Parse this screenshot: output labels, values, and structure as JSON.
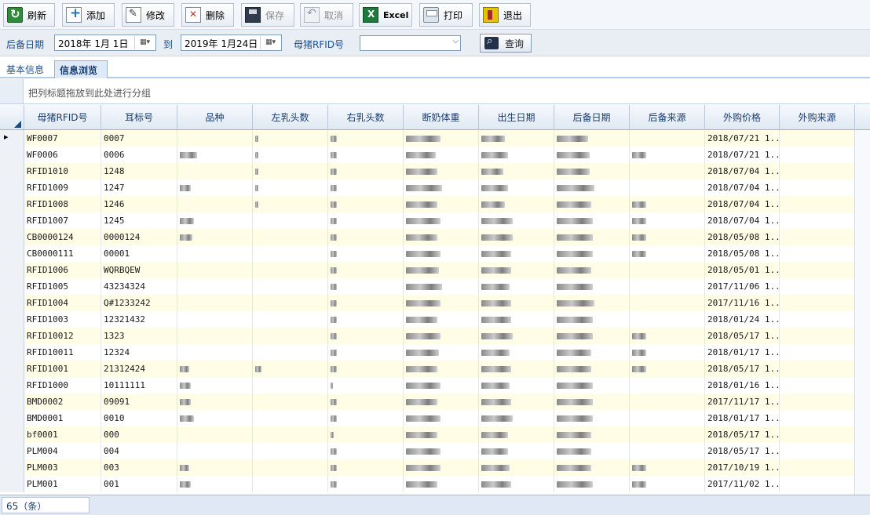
{
  "toolbar": {
    "buttons": [
      {
        "label": "刷新",
        "icon": "refresh-icon"
      },
      {
        "label": "添加",
        "icon": "add-icon"
      },
      {
        "label": "修改",
        "icon": "edit-icon"
      },
      {
        "label": "删除",
        "icon": "delete-icon"
      },
      {
        "label": "保存",
        "icon": "save-icon",
        "disabled": true
      },
      {
        "label": "取消",
        "icon": "cancel-icon",
        "disabled": true
      },
      {
        "label": "Excel",
        "icon": "excel-icon"
      },
      {
        "label": "打印",
        "icon": "print-icon"
      },
      {
        "label": "退出",
        "icon": "exit-icon"
      }
    ]
  },
  "filter": {
    "date_label": "后备日期",
    "start_date": "2018年 1月 1日",
    "to_label": "到",
    "end_date": "2019年 1月24日",
    "rfid_label": "母猪RFID号",
    "rfid_value": "",
    "query_label": "查询"
  },
  "tabs": [
    {
      "label": "基本信息",
      "active": false
    },
    {
      "label": "信息浏览",
      "active": true
    }
  ],
  "group_hint": "把列标题拖放到此处进行分组",
  "grid": {
    "columns": [
      "母猪RFID号",
      "耳标号",
      "品种",
      "左乳头数",
      "右乳头数",
      "断奶体重",
      "出生日期",
      "后备日期",
      "后备来源",
      "外购价格",
      "外购来源"
    ],
    "rows": [
      {
        "rfid": "WF0007",
        "ear": "0007",
        "price": "2018/07/21 1..."
      },
      {
        "rfid": "WF0006",
        "ear": "0006",
        "price": "2018/07/21 1..."
      },
      {
        "rfid": "RFID1010",
        "ear": "1248",
        "price": "2018/07/04 1..."
      },
      {
        "rfid": "RFID1009",
        "ear": "1247",
        "price": "2018/07/04 1..."
      },
      {
        "rfid": "RFID1008",
        "ear": "1246",
        "price": "2018/07/04 1..."
      },
      {
        "rfid": "RFID1007",
        "ear": "1245",
        "price": "2018/07/04 1..."
      },
      {
        "rfid": "CB0000124",
        "ear": "0000124",
        "price": "2018/05/08 1..."
      },
      {
        "rfid": "CB0000111",
        "ear": "00001",
        "price": "2018/05/08 1..."
      },
      {
        "rfid": "RFID1006",
        "ear": "WQRBQEW",
        "price": "2018/05/01 1..."
      },
      {
        "rfid": "RFID1005",
        "ear": "43234324",
        "price": "2017/11/06 1..."
      },
      {
        "rfid": "RFID1004",
        "ear": "Q#1233242",
        "price": "2017/11/16 1..."
      },
      {
        "rfid": "RFID1003",
        "ear": "12321432",
        "price": "2018/01/24 1..."
      },
      {
        "rfid": "RFID10012",
        "ear": "1323",
        "price": "2018/05/17 1..."
      },
      {
        "rfid": "RFID10011",
        "ear": "12324",
        "price": "2018/01/17 1..."
      },
      {
        "rfid": "RFID1001",
        "ear": "21312424",
        "price": "2018/05/17 1..."
      },
      {
        "rfid": "RFID1000",
        "ear": "10111111",
        "price": "2018/01/16 1..."
      },
      {
        "rfid": "BMD0002",
        "ear": "09091",
        "price": "2017/11/17 1..."
      },
      {
        "rfid": "BMD0001",
        "ear": "0010",
        "price": "2018/01/17 1..."
      },
      {
        "rfid": "bf0001",
        "ear": "000",
        "price": "2018/05/17 1..."
      },
      {
        "rfid": "PLM004",
        "ear": "004",
        "price": "2018/05/17 1..."
      },
      {
        "rfid": "PLM003",
        "ear": "003",
        "price": "2017/10/19 1..."
      },
      {
        "rfid": "PLM001",
        "ear": "001",
        "price": "2017/11/02 1..."
      }
    ]
  },
  "footer": {
    "count": "65（条）"
  }
}
